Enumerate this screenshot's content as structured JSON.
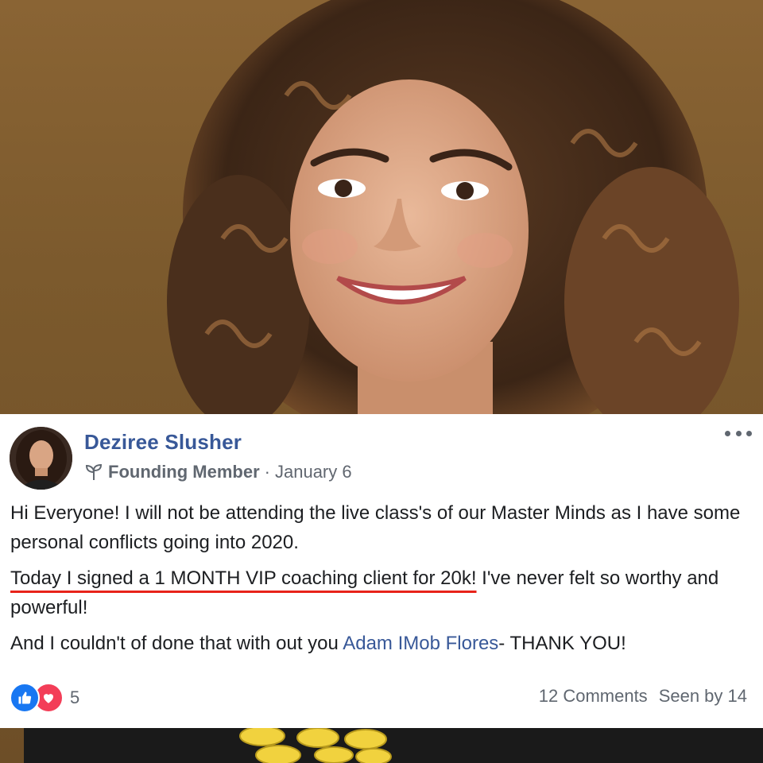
{
  "post": {
    "author": "Deziree Slusher",
    "badge": "Founding Member",
    "separator": "·",
    "date": "January 6",
    "paragraph1": "Hi Everyone! I will not be attending the live class's of our Master Minds as I have some personal conflicts going into 2020.",
    "paragraph2_highlight": "Today I signed a 1 MONTH VIP coaching client for 20k!",
    "paragraph2_rest": " I've never felt so worthy and powerful!",
    "paragraph3_start": "And I couldn't of done that with out you ",
    "paragraph3_mention": "Adam IMob Flores",
    "paragraph3_end": "- THANK YOU!",
    "reaction_count": "5",
    "comments": "12 Comments",
    "seen_by": "Seen by 14"
  },
  "icons": {
    "badge": "sprout-icon",
    "more": "more-options-icon",
    "like": "like-icon",
    "love": "love-icon"
  },
  "colors": {
    "link": "#385898",
    "highlight_underline": "#e8231a",
    "like": "#1877f2",
    "love": "#f33e58"
  }
}
